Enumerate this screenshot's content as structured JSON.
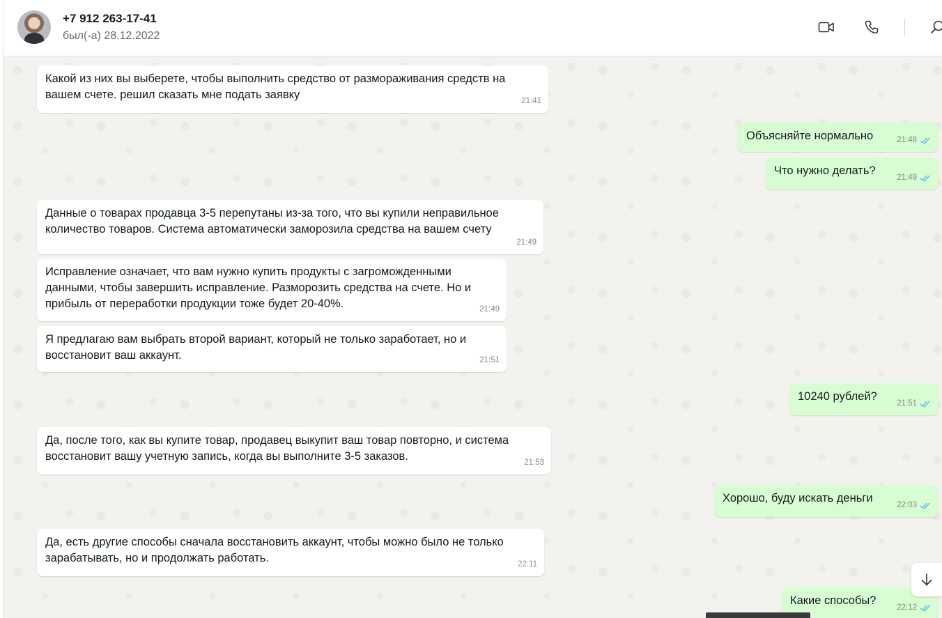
{
  "header": {
    "contact_name": "+7 912 263-17-41",
    "status": "был(-а) 28.12.2022",
    "icons": [
      "video-call-icon",
      "voice-call-icon",
      "search-icon"
    ]
  },
  "colors": {
    "incoming_bubble": "#ffffff",
    "outgoing_bubble": "#d9fdd3",
    "read_ticks": "#53bdeb",
    "chat_background": "#f3f2ef"
  },
  "messages": [
    {
      "dir": "in",
      "text": "Какой из них вы выберете, чтобы выполнить средство от размораживания средств на вашем счете. решил сказать мне подать заявку",
      "time": "21:41"
    },
    {
      "dir": "out",
      "text": "Объясняйте нормально",
      "time": "21:48"
    },
    {
      "dir": "out",
      "text": "Что нужно делать?",
      "time": "21:49"
    },
    {
      "dir": "in",
      "text": "Данные о товарах продавца 3-5 перепутаны из-за того, что вы купили неправильное количество товаров. Система автоматически заморозила средства на вашем счету",
      "time": "21:49"
    },
    {
      "dir": "in",
      "text": "Исправление означает, что вам нужно купить продукты с загроможденными данными, чтобы завершить исправление. Разморозить средства на счете. Но и прибыль от переработки продукции тоже будет 20-40%.",
      "time": "21:49"
    },
    {
      "dir": "in",
      "text": "Я предлагаю вам выбрать второй вариант, который не только заработает, но и восстановит ваш аккаунт.",
      "time": "21:51"
    },
    {
      "dir": "out",
      "text": "10240 рублей?",
      "time": "21:51"
    },
    {
      "dir": "in",
      "text": "Да, после того, как вы купите товар, продавец выкупит ваш товар повторно, и система восстановит вашу учетную запись, когда вы выполните 3-5 заказов.",
      "time": "21:53"
    },
    {
      "dir": "out",
      "text": "Хорошо, буду искать деньги",
      "time": "22:03"
    },
    {
      "dir": "in",
      "text": "Да, есть другие способы сначала восстановить аккаунт, чтобы можно было не только зарабатывать, но и продолжать работать.",
      "time": "22:11"
    },
    {
      "dir": "out",
      "text": "Какие способы?",
      "time": "22:12"
    }
  ]
}
